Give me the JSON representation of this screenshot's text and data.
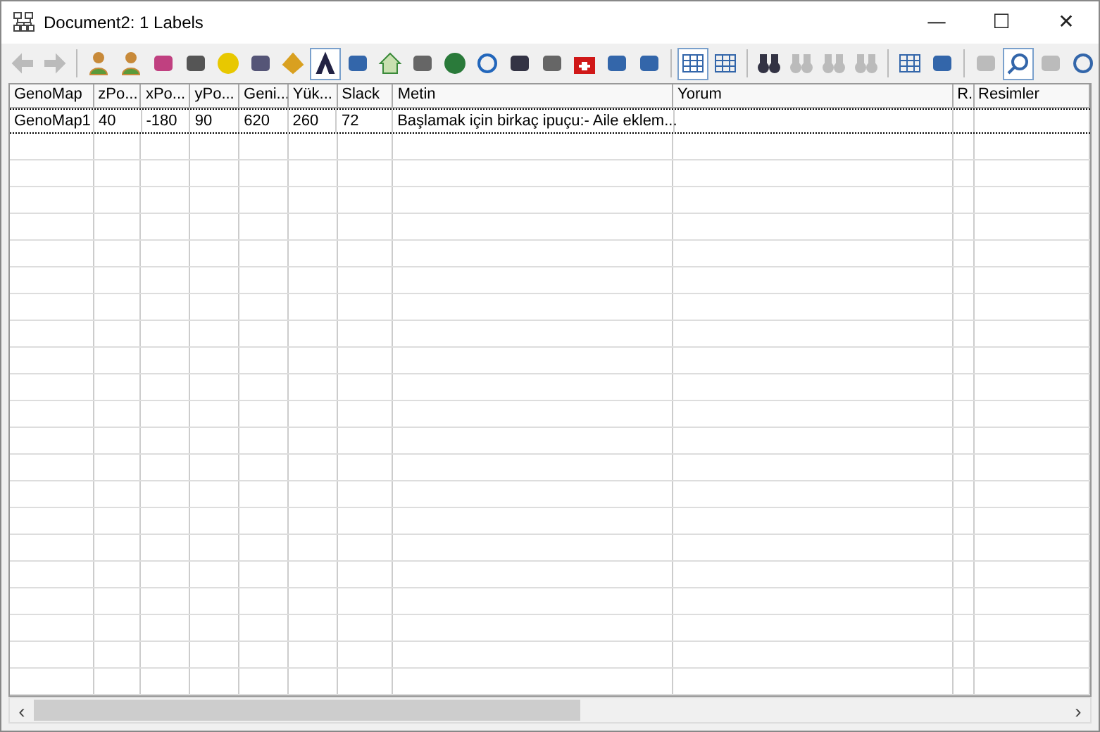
{
  "window": {
    "title": "Document2: 1 Labels",
    "controls": [
      "—",
      "☐",
      "✕"
    ]
  },
  "toolbar": [
    {
      "kind": "button",
      "disabled": true,
      "pressed": false
    },
    {
      "kind": "button",
      "disabled": true,
      "pressed": false
    },
    {
      "kind": "separator"
    },
    {
      "kind": "button",
      "disabled": false,
      "pressed": false
    },
    {
      "kind": "button",
      "disabled": false,
      "pressed": false
    },
    {
      "kind": "button",
      "disabled": false,
      "pressed": false
    },
    {
      "kind": "button",
      "disabled": false,
      "pressed": false
    },
    {
      "kind": "button",
      "disabled": false,
      "pressed": false
    },
    {
      "kind": "button",
      "disabled": false,
      "pressed": false
    },
    {
      "kind": "button",
      "disabled": false,
      "pressed": false
    },
    {
      "kind": "button",
      "disabled": false,
      "pressed": true
    },
    {
      "kind": "button",
      "disabled": false,
      "pressed": false
    },
    {
      "kind": "button",
      "disabled": false,
      "pressed": false
    },
    {
      "kind": "button",
      "disabled": false,
      "pressed": false
    },
    {
      "kind": "button",
      "disabled": false,
      "pressed": false
    },
    {
      "kind": "button",
      "disabled": false,
      "pressed": false
    },
    {
      "kind": "button",
      "disabled": false,
      "pressed": false
    },
    {
      "kind": "button",
      "disabled": false,
      "pressed": false
    },
    {
      "kind": "button",
      "disabled": false,
      "pressed": false
    },
    {
      "kind": "button",
      "disabled": false,
      "pressed": false
    },
    {
      "kind": "button",
      "disabled": false,
      "pressed": false
    },
    {
      "kind": "separator"
    },
    {
      "kind": "button",
      "disabled": false,
      "pressed": true
    },
    {
      "kind": "button",
      "disabled": false,
      "pressed": false
    },
    {
      "kind": "separator"
    },
    {
      "kind": "button",
      "disabled": false,
      "pressed": false
    },
    {
      "kind": "button",
      "disabled": true,
      "pressed": false
    },
    {
      "kind": "button",
      "disabled": true,
      "pressed": false
    },
    {
      "kind": "button",
      "disabled": true,
      "pressed": false
    },
    {
      "kind": "separator"
    },
    {
      "kind": "button",
      "disabled": false,
      "pressed": false
    },
    {
      "kind": "button",
      "disabled": false,
      "pressed": false
    },
    {
      "kind": "separator"
    },
    {
      "kind": "button",
      "disabled": true,
      "pressed": false
    },
    {
      "kind": "button",
      "disabled": false,
      "pressed": true
    },
    {
      "kind": "button",
      "disabled": true,
      "pressed": false
    },
    {
      "kind": "button",
      "disabled": false,
      "pressed": false
    }
  ],
  "table": {
    "columns": [
      "GenoMap",
      "zPo...",
      "xPo...",
      "yPo...",
      "Geni...",
      "Yük...",
      "Slack",
      "Metin",
      "Yorum",
      "R.",
      "Resimler"
    ],
    "rows": [
      [
        "GenoMap1",
        "40",
        "-180",
        "90",
        "620",
        "260",
        "72",
        "Başlamak için birkaç ipuçu:- Aile eklem...",
        "",
        "",
        ""
      ]
    ]
  },
  "scrollbar": {
    "left": "‹",
    "right": "›"
  }
}
